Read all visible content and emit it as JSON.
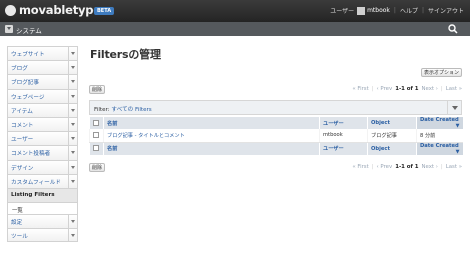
{
  "header": {
    "logo_text": "movabletype",
    "beta_badge": "BETA",
    "user_label": "ユーザー",
    "username": "mtbook",
    "help": "ヘルプ",
    "sign_out": "サインアウト"
  },
  "scope": {
    "label": "システム"
  },
  "sidebar": {
    "items": [
      {
        "label": "ウェブサイト"
      },
      {
        "label": "ブログ"
      },
      {
        "label": "ブログ記事"
      },
      {
        "label": "ウェブページ"
      },
      {
        "label": "アイテム"
      },
      {
        "label": "コメント"
      },
      {
        "label": "ユーザー"
      },
      {
        "label": "コメント投稿者"
      },
      {
        "label": "デザイン"
      },
      {
        "label": "カスタムフィールド"
      }
    ],
    "active_label": "Listing Filters",
    "active_sub": "一覧",
    "bottom": [
      {
        "label": "設定"
      },
      {
        "label": "ツール"
      }
    ]
  },
  "main": {
    "title": "Filtersの管理",
    "delete_button": "削除",
    "display_options": "表示オプション",
    "pager": {
      "first": "« First",
      "prev": "‹ Prev",
      "range": "1-1 of 1",
      "next": "Next ›",
      "last": "Last »"
    },
    "filter": {
      "label": "Filter:",
      "value": "すべての Filters"
    },
    "columns": {
      "name": "名前",
      "user": "ユーザー",
      "object": "Object",
      "date": "Date Created"
    },
    "rows": [
      {
        "name": "ブログ記事 - タイトルとコメント",
        "user": "mtbook",
        "object": "ブログ記事",
        "date": "8 分前"
      }
    ]
  }
}
